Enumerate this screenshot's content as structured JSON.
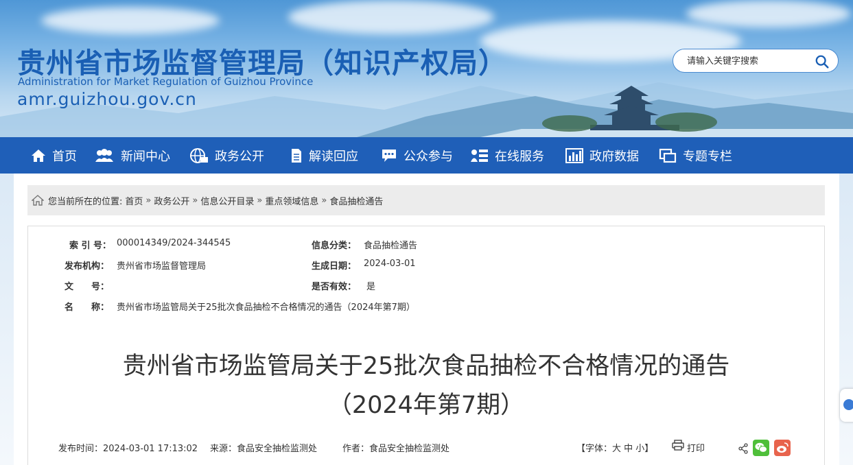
{
  "header": {
    "title_cn": "贵州省市场监督管理局（知识产权局）",
    "title_en": "Administration for Market Regulation of Guizhou Province",
    "domain": "amr.guizhou.gov.cn",
    "search_placeholder": "请输入关键字搜索"
  },
  "nav": {
    "items": [
      {
        "label": "首页",
        "icon": "home-icon"
      },
      {
        "label": "新闻中心",
        "icon": "users-icon"
      },
      {
        "label": "政务公开",
        "icon": "globe-icon"
      },
      {
        "label": "解读回应",
        "icon": "document-icon"
      },
      {
        "label": "公众参与",
        "icon": "chat-icon"
      },
      {
        "label": "在线服务",
        "icon": "service-icon"
      },
      {
        "label": "政府数据",
        "icon": "bar-chart-icon"
      },
      {
        "label": "专题专栏",
        "icon": "window-icon"
      }
    ]
  },
  "breadcrumb": {
    "prefix": "您当前所在的位置:",
    "items": [
      "首页",
      "政务公开",
      "信息公开目录",
      "重点领域信息",
      "食品抽检通告"
    ],
    "separator": "»"
  },
  "meta": {
    "index_label": "索 引 号：",
    "index_value": "000014349/2024-344545",
    "category_label": "信息分类：",
    "category_value": "食品抽检通告",
    "publisher_label": "发布机构：",
    "publisher_value": "贵州省市场监督管理局",
    "date_label": "生成日期：",
    "date_value": "2024-03-01",
    "docno_label": "文　　号：",
    "docno_value": "",
    "valid_label": "是否有效：",
    "valid_value": "是",
    "name_label": "名　　称：",
    "name_value": "贵州省市场监管局关于25批次食品抽检不合格情况的通告（2024年第7期）"
  },
  "article": {
    "title_line1": "贵州省市场监管局关于25批次食品抽检不合格情况的通告",
    "title_line2": "（2024年第7期）",
    "publish_time": "发布时间：2024-03-01 17:13:02",
    "source": "来源：食品安全抽检监测处",
    "author": "作者：食品安全抽检监测处",
    "font_size_label": "【字体：大 中 小】",
    "print_label": "打印"
  },
  "colors": {
    "nav_bg": "#1f5fb8",
    "title_blue": "#1a5fb4",
    "wechat_green": "#4fbf3a",
    "weibo_red": "#e8644d"
  }
}
